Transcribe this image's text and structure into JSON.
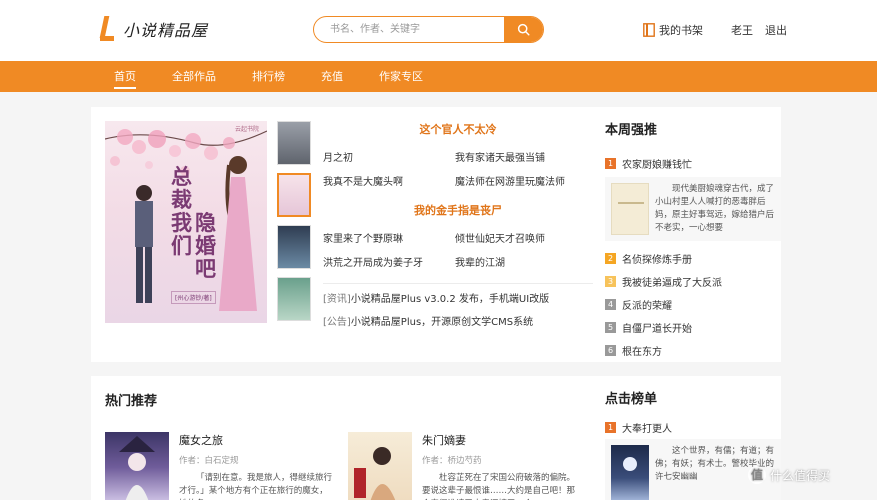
{
  "header": {
    "logo_text": "小说精品屋",
    "search_placeholder": "书名、作者、关键字",
    "bookshelf_label": "我的书架",
    "username": "老王",
    "logout_label": "退出"
  },
  "nav": {
    "items": [
      {
        "label": "首页",
        "active": true
      },
      {
        "label": "全部作品",
        "active": false
      },
      {
        "label": "排行榜",
        "active": false
      },
      {
        "label": "充值",
        "active": false
      },
      {
        "label": "作家专区",
        "active": false
      }
    ]
  },
  "featured": {
    "cover": {
      "title_line1": "总裁我们",
      "title_line2": "隐婚吧",
      "author_tag": "[州心游钞/著]",
      "brand": "云起书院"
    },
    "blocks": [
      {
        "title": "这个官人不太冷",
        "books": [
          "月之初",
          "我有家诸天最强当铺",
          "我真不是大魔头啊",
          "魔法师在网游里玩魔法师"
        ]
      },
      {
        "title": "我的金手指是丧尸",
        "books": [
          "家里来了个野原琳",
          "倾世仙妃天才召唤师",
          "洪荒之开局成为姜子牙",
          "我辈的江湖"
        ]
      }
    ],
    "news": [
      {
        "tag": "[资讯]",
        "text": "小说精品屋Plus v3.0.2 发布，手机端UI改版"
      },
      {
        "tag": "[公告]",
        "text": "小说精品屋Plus，开源原创文学CMS系统"
      }
    ]
  },
  "weekly": {
    "title": "本周强推",
    "top_desc": "现代美厨娘魂穿古代，成了小山村里人人喊打的恶毒胖后妈，原主好事驾远，嫁给猎户后不老实，一心想要",
    "top_cover_text": "农家厨娘赚钱忙",
    "items": [
      {
        "rank": "1",
        "title": "农家厨娘赚钱忙",
        "color": "#e8732a"
      },
      {
        "rank": "2",
        "title": "名侦探修炼手册",
        "color": "#f5a623"
      },
      {
        "rank": "3",
        "title": "我被徒弟逼成了大反派",
        "color": "#f7c35b"
      },
      {
        "rank": "4",
        "title": "反派的荣耀",
        "color": "#999999"
      },
      {
        "rank": "5",
        "title": "自僵尸道长开始",
        "color": "#999999"
      },
      {
        "rank": "6",
        "title": "根在东方",
        "color": "#999999"
      }
    ]
  },
  "hot": {
    "title": "热门推荐",
    "books": [
      {
        "name": "魔女之旅",
        "author": "作者：白石定规",
        "desc": "「请别在意。我是旅人，得继续旅行才行。」某个地方有个正在旅行的魔女，她的名"
      },
      {
        "name": "朱门嫡妻",
        "author": "作者：桥边芍药",
        "desc": "杜容芷死在了宋国公府破落的偏院。要说这辈子最恨谁……大约是自己吧！那个蠢得谁请了大房还嫁了一个"
      }
    ]
  },
  "click_rank": {
    "title": "点击榜单",
    "top": {
      "rank": "1",
      "title": "大奉打更人",
      "color": "#e8732a"
    },
    "desc": "这个世界，有儒；有道；有佛；有妖；有术士。警校毕业的许七安幽幽"
  },
  "watermark": {
    "badge": "值",
    "text": "什么值得买"
  }
}
